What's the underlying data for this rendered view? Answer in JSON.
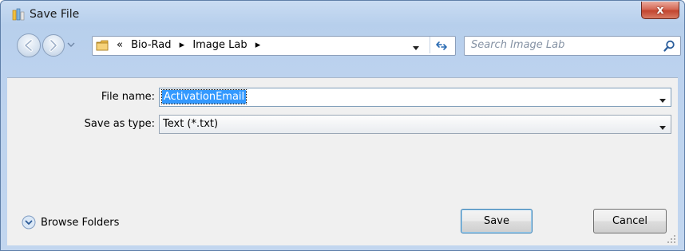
{
  "window": {
    "title": "Save File",
    "close_label": "x"
  },
  "nav": {
    "overflow_marker": "«",
    "breadcrumbs": [
      "Bio-Rad",
      "Image Lab"
    ],
    "search_placeholder": "Search Image Lab"
  },
  "form": {
    "file_name_label": "File name:",
    "file_name_value": "ActivationEmail",
    "save_as_type_label": "Save as type:",
    "save_as_type_value": "Text (*.txt)"
  },
  "footer": {
    "browse_folders_label": "Browse Folders",
    "save_label": "Save",
    "cancel_label": "Cancel"
  },
  "colors": {
    "accent": "#3399ff",
    "close_button": "#c3452f",
    "window_frame": "#b9cfec"
  },
  "icons": [
    "app-icon",
    "close-icon",
    "back-icon",
    "forward-icon",
    "chevron-down-icon",
    "folder-icon",
    "breadcrumb-arrow-icon",
    "refresh-icon",
    "search-icon",
    "expand-icon",
    "resize-grip-icon"
  ]
}
